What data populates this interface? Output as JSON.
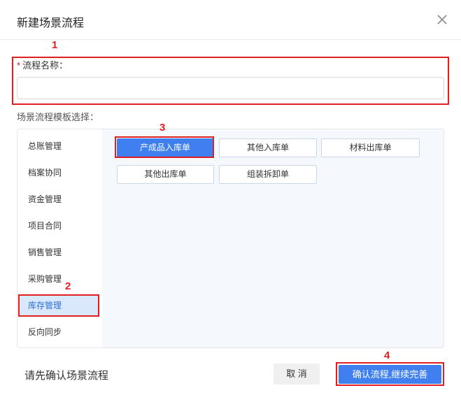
{
  "dialog": {
    "title": "新建场景流程",
    "close_icon": "close-icon"
  },
  "annotations": [
    "1",
    "2",
    "3",
    "4"
  ],
  "name_field": {
    "required_mark": "*",
    "label": "流程名称：",
    "value": "",
    "placeholder": ""
  },
  "template": {
    "label": "场景流程模板选择："
  },
  "sidebar": {
    "items": [
      {
        "label": "总账管理"
      },
      {
        "label": "档案协同"
      },
      {
        "label": "资金管理"
      },
      {
        "label": "项目合同"
      },
      {
        "label": "销售管理"
      },
      {
        "label": "采购管理"
      },
      {
        "label": "库存管理",
        "active": true
      },
      {
        "label": "反向同步"
      }
    ]
  },
  "templates": [
    {
      "label": "产成品入库单",
      "active": true
    },
    {
      "label": "其他入库单"
    },
    {
      "label": "材料出库单"
    },
    {
      "label": "其他出库单"
    },
    {
      "label": "组装拆卸单"
    }
  ],
  "footer": {
    "message": "请先确认场景流程",
    "cancel_label": "取 消",
    "confirm_label": "确认流程,继续完善"
  },
  "colors": {
    "accent": "#3f7ff0",
    "annotation": "#e02020",
    "active_sidebar_bg": "#d9e8fb"
  }
}
